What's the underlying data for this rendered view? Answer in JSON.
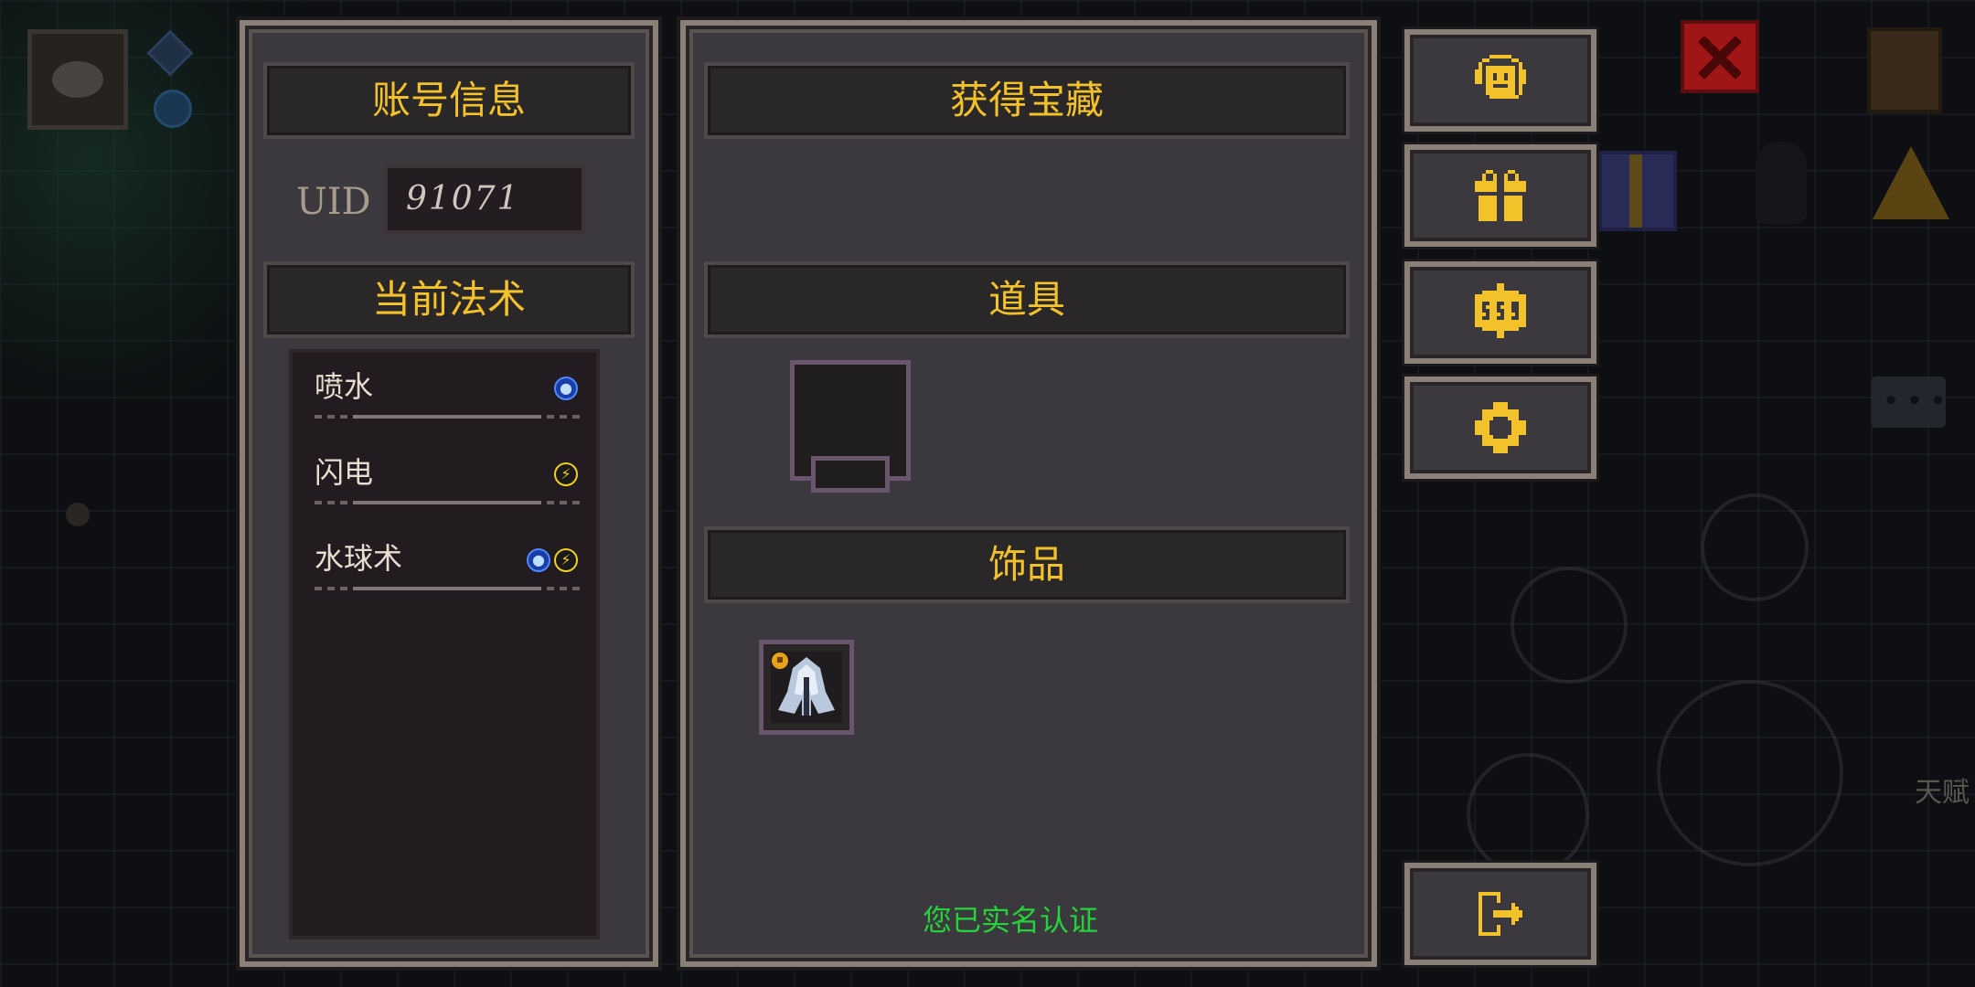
{
  "account_panel": {
    "title": "账号信息",
    "uid_label": "UID",
    "uid_value": "91071",
    "spells_title": "当前法术",
    "spells": [
      {
        "name": "喷水",
        "elements": [
          "water-icon"
        ]
      },
      {
        "name": "闪电",
        "elements": [
          "lightning-icon"
        ]
      },
      {
        "name": "水球术",
        "elements": [
          "water-icon",
          "lightning-icon"
        ]
      }
    ]
  },
  "treasure_panel": {
    "title": "获得宝藏",
    "items_title": "道具",
    "accessories_title": "饰品",
    "accessories": [
      {
        "icon": "cloak-icon"
      }
    ],
    "verify_status": "您已实名认证"
  },
  "side_buttons": [
    {
      "name": "customer-service-button",
      "icon": "headset-icon"
    },
    {
      "name": "gift-button",
      "icon": "gift-icon"
    },
    {
      "name": "redeem-code-button",
      "icon": "badge-icon"
    },
    {
      "name": "settings-button",
      "icon": "gear-icon"
    },
    {
      "name": "logout-button",
      "icon": "logout-icon"
    }
  ],
  "background": {
    "talent_label": "天赋"
  },
  "colors": {
    "title_gold": "#f3c12a",
    "verify_green": "#25d23a",
    "panel_bg": "#3c393e",
    "panel_border": "#8a8078",
    "close_red": "#a01616"
  }
}
